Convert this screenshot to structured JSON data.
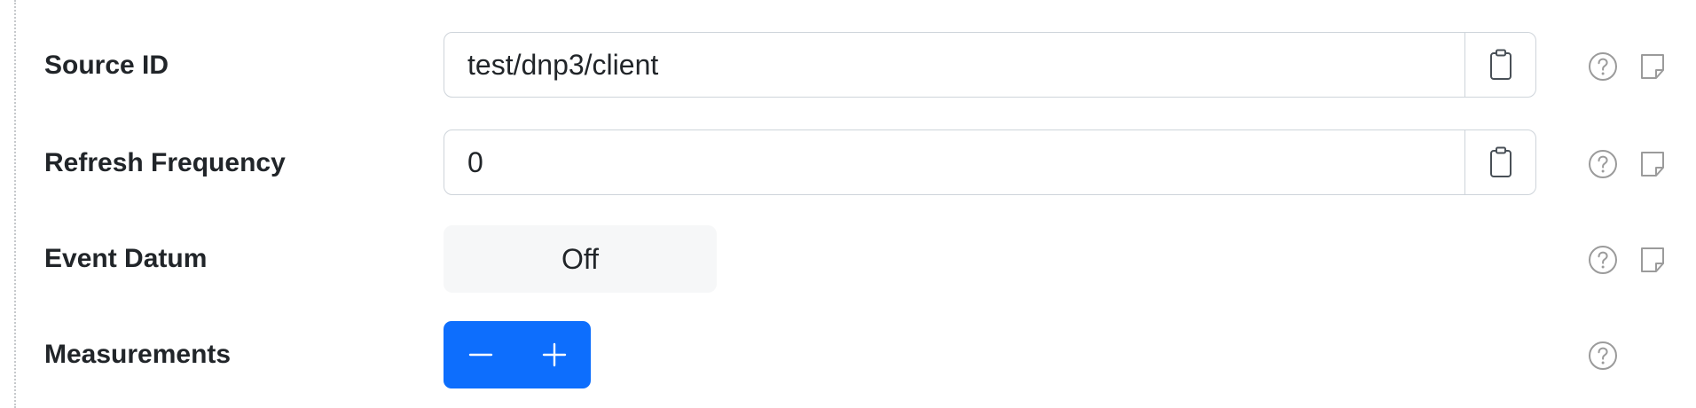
{
  "settings": {
    "source_id": {
      "label": "Source ID",
      "value": "test/dnp3/client",
      "paste_icon": "clipboard-icon",
      "help_icon": "question-circle-icon",
      "note_icon": "sticky-note-icon"
    },
    "refresh_frequency": {
      "label": "Refresh Frequency",
      "value": "0",
      "paste_icon": "clipboard-icon",
      "help_icon": "question-circle-icon",
      "note_icon": "sticky-note-icon"
    },
    "event_datum": {
      "label": "Event Datum",
      "toggle_label": "Off",
      "help_icon": "question-circle-icon",
      "note_icon": "sticky-note-icon"
    },
    "measurements": {
      "label": "Measurements",
      "decrement_icon": "minus-icon",
      "increment_icon": "plus-icon",
      "help_icon": "question-circle-icon"
    }
  },
  "colors": {
    "accent": "#0d6efd",
    "toggle_bg": "#f6f7f8",
    "border": "#ced4da",
    "icon_gray": "#9b9b9b",
    "text": "#212529"
  }
}
